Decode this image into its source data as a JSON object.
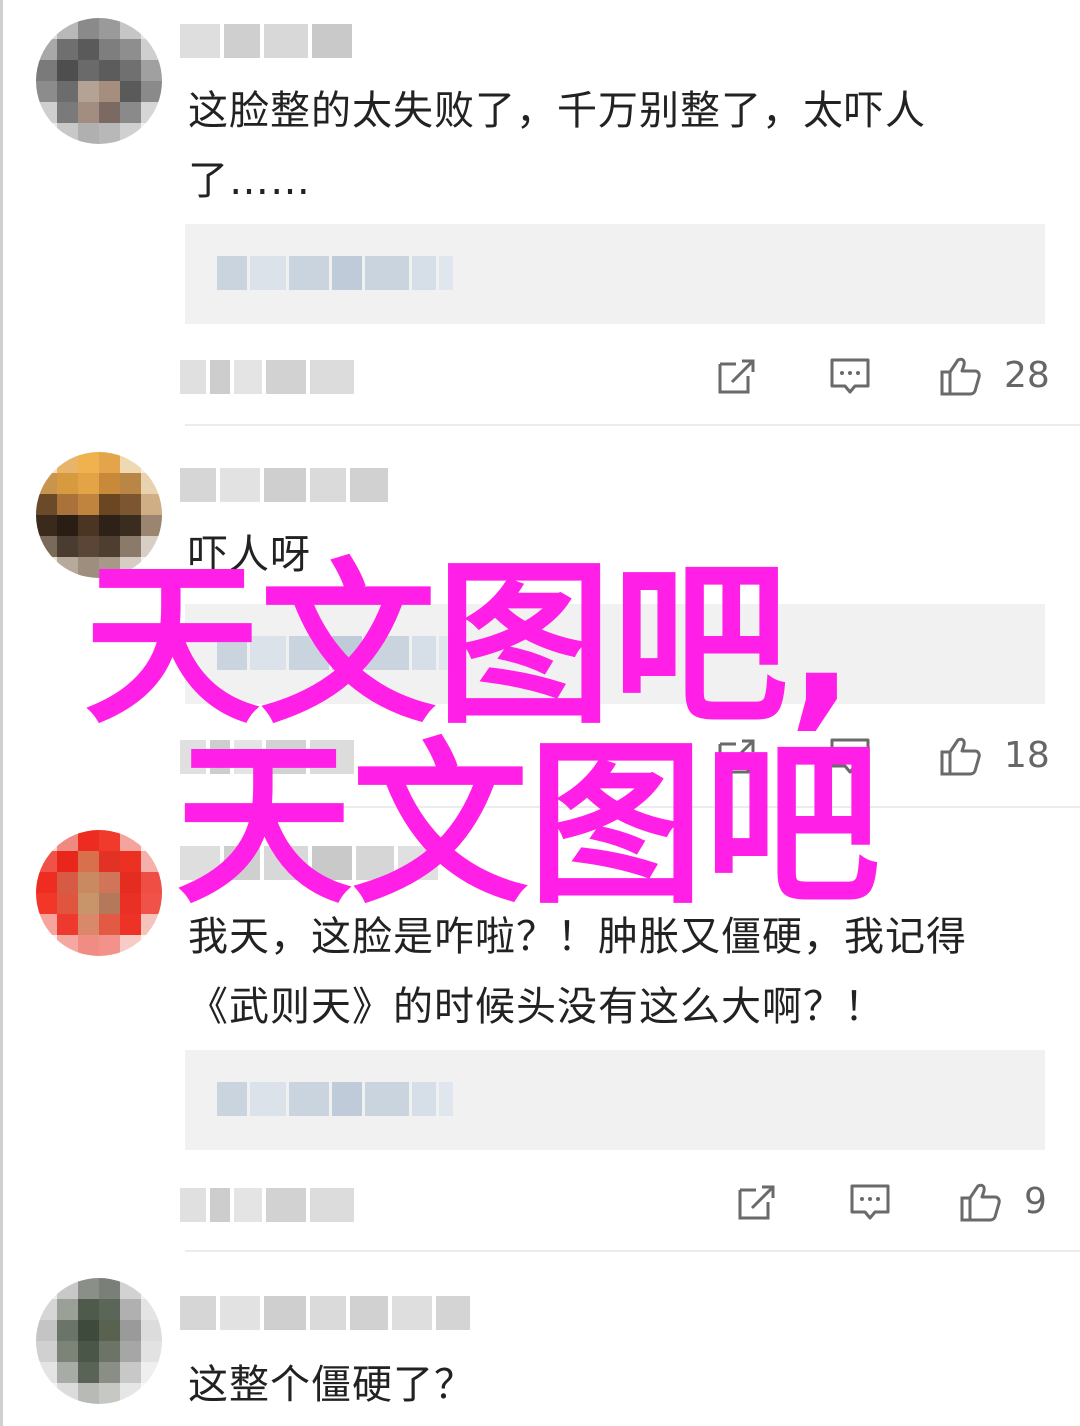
{
  "comments": [
    {
      "text_line1": "这脸整的太失败了，千万别整了，太吓人",
      "text_line2": "了……",
      "likes": "28"
    },
    {
      "text_line1": "吓人呀",
      "likes": "18"
    },
    {
      "text_line1": "我天，这脸是咋啦？！肿胀又僵硬，我记得",
      "text_line2": "《武则天》的时候头没有这么大啊？！",
      "likes": "9"
    },
    {
      "text_line1": "这整个僵硬了？"
    }
  ],
  "watermark": {
    "line1": "天文图吧,",
    "line2": "天文图吧",
    "color": "#ff1fe6"
  },
  "icons": [
    "share-icon",
    "reply-icon",
    "thumbs-up-icon"
  ]
}
